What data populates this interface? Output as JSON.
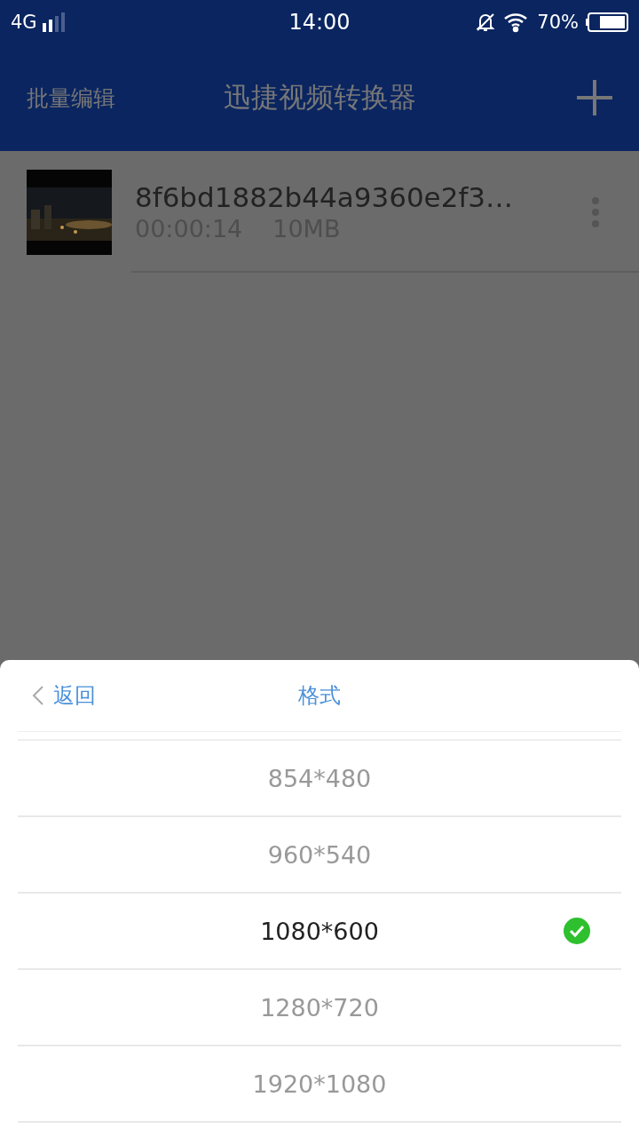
{
  "status_bar": {
    "network": "4G",
    "time": "14:00",
    "battery": "70%"
  },
  "header": {
    "left_action": "批量编辑",
    "title": "迅捷视频转换器"
  },
  "files": [
    {
      "name": "8f6bd1882b44a9360e2f3…",
      "duration": "00:00:14",
      "size": "10MB"
    }
  ],
  "sheet": {
    "back": "返回",
    "title": "格式",
    "options": [
      {
        "label": "854*480",
        "selected": false
      },
      {
        "label": "960*540",
        "selected": false
      },
      {
        "label": "1080*600",
        "selected": true
      },
      {
        "label": "1280*720",
        "selected": false
      },
      {
        "label": "1920*1080",
        "selected": false
      }
    ]
  }
}
